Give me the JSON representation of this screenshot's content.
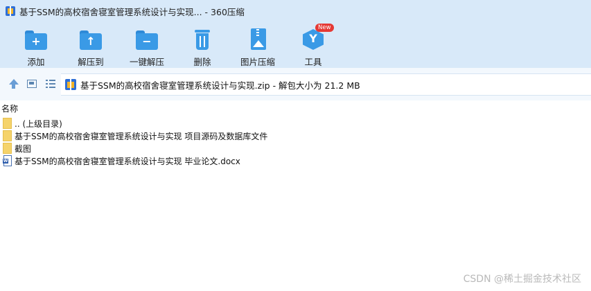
{
  "window": {
    "title": "基于SSM的高校宿舍寝室管理系统设计与实现... - 360压缩"
  },
  "toolbar": {
    "items": [
      {
        "label": "添加",
        "icon": "add-folder-icon"
      },
      {
        "label": "解压到",
        "icon": "extract-to-icon"
      },
      {
        "label": "一键解压",
        "icon": "one-click-extract-icon"
      },
      {
        "label": "删除",
        "icon": "delete-icon"
      },
      {
        "label": "图片压缩",
        "icon": "image-compress-icon"
      },
      {
        "label": "工具",
        "icon": "tools-icon",
        "badge": "New"
      }
    ]
  },
  "address": {
    "path": "基于SSM的高校宿舍寝室管理系统设计与实现.zip - 解包大小为 21.2 MB"
  },
  "list": {
    "column_name": "名称",
    "items": [
      {
        "name": ".. (上级目录)",
        "type": "folder"
      },
      {
        "name": "基于SSM的高校宿舍寝室管理系统设计与实现 项目源码及数据库文件",
        "type": "folder"
      },
      {
        "name": "截图",
        "type": "folder"
      },
      {
        "name": "基于SSM的高校宿舍寝室管理系统设计与实现 毕业论文.docx",
        "type": "docx"
      }
    ]
  },
  "watermark": "CSDN @稀土掘金技术社区"
}
